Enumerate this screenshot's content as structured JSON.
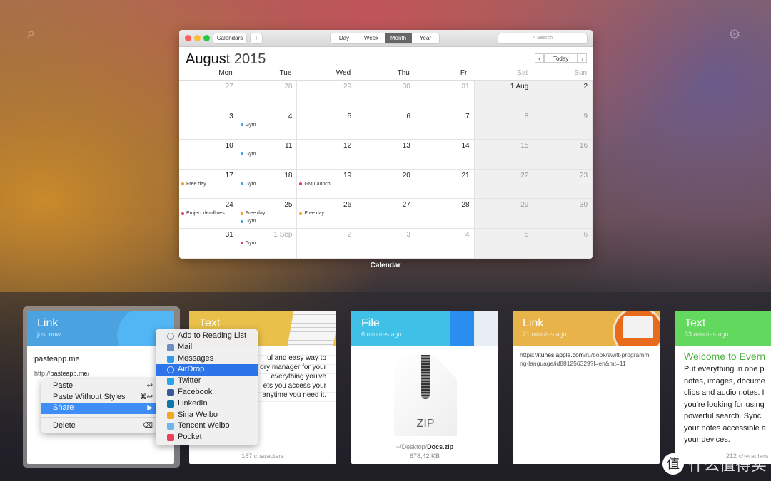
{
  "desktop": {
    "search_icon": "magnifier-icon",
    "settings_icon": "gear-icon"
  },
  "calendar": {
    "toolbar": {
      "calendars": "Calendars",
      "add": "+",
      "views": [
        "Day",
        "Week",
        "Month",
        "Year"
      ],
      "active_view": "Month",
      "search_placeholder": "Search"
    },
    "month": "August",
    "year": "2015",
    "prev": "‹",
    "today": "Today",
    "next": "›",
    "weekdays": [
      "Mon",
      "Tue",
      "Wed",
      "Thu",
      "Fri",
      "Sat",
      "Sun"
    ],
    "weeks": [
      [
        {
          "d": "27",
          "dim": true
        },
        {
          "d": "28",
          "dim": true
        },
        {
          "d": "29",
          "dim": true
        },
        {
          "d": "30",
          "dim": true
        },
        {
          "d": "31",
          "dim": true
        },
        {
          "d": "1 Aug"
        },
        {
          "d": "2"
        }
      ],
      [
        {
          "d": "3"
        },
        {
          "d": "4",
          "ev": [
            {
              "t": "Gym",
              "c": "#3aa6e8"
            }
          ]
        },
        {
          "d": "5"
        },
        {
          "d": "6"
        },
        {
          "d": "7"
        },
        {
          "d": "8"
        },
        {
          "d": "9"
        }
      ],
      [
        {
          "d": "10"
        },
        {
          "d": "11",
          "ev": [
            {
              "t": "Gym",
              "c": "#3aa6e8"
            }
          ]
        },
        {
          "d": "12"
        },
        {
          "d": "13"
        },
        {
          "d": "14"
        },
        {
          "d": "15"
        },
        {
          "d": "16"
        }
      ],
      [
        {
          "d": "17",
          "ev": [
            {
              "t": "Free day",
              "c": "#f59a23"
            }
          ]
        },
        {
          "d": "18",
          "ev": [
            {
              "t": "Gym",
              "c": "#3aa6e8"
            }
          ]
        },
        {
          "d": "19",
          "ev": [
            {
              "t": "GM Launch",
              "c": "#e8336b"
            }
          ]
        },
        {
          "d": "20"
        },
        {
          "d": "21"
        },
        {
          "d": "22"
        },
        {
          "d": "23"
        }
      ],
      [
        {
          "d": "24",
          "ev": [
            {
              "t": "Project deadlines",
              "c": "#e8336b"
            }
          ]
        },
        {
          "d": "25",
          "ev": [
            {
              "t": "Free day",
              "c": "#f59a23"
            },
            {
              "t": "Gym",
              "c": "#3aa6e8"
            }
          ]
        },
        {
          "d": "26",
          "ev": [
            {
              "t": "Free day",
              "c": "#f59a23"
            }
          ]
        },
        {
          "d": "27"
        },
        {
          "d": "28"
        },
        {
          "d": "29"
        },
        {
          "d": "30"
        }
      ],
      [
        {
          "d": "31"
        },
        {
          "d": "1 Sep",
          "dim": true,
          "ev": [
            {
              "t": "Gym",
              "c": "#e8336b"
            }
          ]
        },
        {
          "d": "2",
          "dim": true
        },
        {
          "d": "3",
          "dim": true
        },
        {
          "d": "4",
          "dim": true
        },
        {
          "d": "5",
          "dim": true
        },
        {
          "d": "6",
          "dim": true
        }
      ]
    ],
    "app_label": "Calendar"
  },
  "cards": [
    {
      "type": "Link",
      "time": "just now",
      "color": "#4aa3e0",
      "title": "pasteapp.me",
      "url_prefix": "http://",
      "url_host": "pasteapp.me",
      "url_suffix": "/"
    },
    {
      "type": "Text",
      "time": "",
      "color": "#e8c04a",
      "lines": [
        "ul and easy way to",
        "ory manager for your",
        "everything you've",
        "ets you access your",
        "anytime you need it."
      ],
      "footer": "187 characters"
    },
    {
      "type": "File",
      "time": "6 minutes ago",
      "color": "#3fc0e6",
      "icon_label": "ZIP",
      "path_prefix": "~/Desktop/",
      "filename": "Docs.zip",
      "size": "678,42 KB"
    },
    {
      "type": "Link",
      "time": "21 minutes ago",
      "color": "#e8b44a",
      "url_prefix": "https://",
      "url_host": "itunes.apple.com",
      "url_suffix": "/ru/book/swift-programming-language/id881256329?l=en&mt=11"
    },
    {
      "type": "Text",
      "time": "33 minutes ago",
      "color": "#62d85e",
      "heading": "Welcome to Evern",
      "body": [
        "Put everything in one p",
        "notes, images, docume",
        "clips and audio notes. I",
        "you're looking for using",
        "powerful search. Sync",
        "your notes accessible a",
        "your devices."
      ],
      "footer": "212 characters"
    }
  ],
  "context_menu": {
    "items": [
      {
        "label": "Paste",
        "key": "↩"
      },
      {
        "label": "Paste Without Styles",
        "key": "⌘↩"
      },
      {
        "label": "Share",
        "key": "▶",
        "active": true
      }
    ],
    "delete": {
      "label": "Delete",
      "key": "⌫"
    }
  },
  "share_menu": [
    {
      "label": "Add to Reading List",
      "icon": "glasses-icon",
      "color": ""
    },
    {
      "label": "Mail",
      "icon": "mail-icon",
      "color": "#6a8fc0"
    },
    {
      "label": "Messages",
      "icon": "messages-icon",
      "color": "#2f9bf0"
    },
    {
      "label": "AirDrop",
      "icon": "airdrop-icon",
      "color": "",
      "active": true
    },
    {
      "label": "Twitter",
      "icon": "twitter-icon",
      "color": "#2aa3ef"
    },
    {
      "label": "Facebook",
      "icon": "facebook-icon",
      "color": "#3b5998"
    },
    {
      "label": "LinkedIn",
      "icon": "linkedin-icon",
      "color": "#0e76a8"
    },
    {
      "label": "Sina Weibo",
      "icon": "weibo-icon",
      "color": "#f5a623"
    },
    {
      "label": "Tencent Weibo",
      "icon": "tencent-weibo-icon",
      "color": "#6cb7e8"
    },
    {
      "label": "Pocket",
      "icon": "pocket-icon",
      "color": "#ee4056"
    }
  ],
  "watermark": {
    "badge": "值",
    "text": "什么值得买"
  }
}
